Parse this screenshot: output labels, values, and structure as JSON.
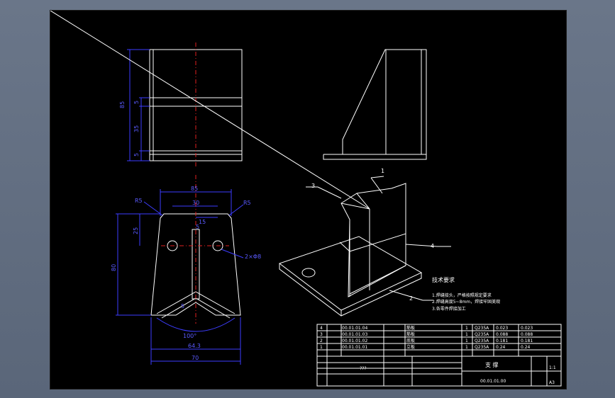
{
  "colors": {
    "background": "#5f6b7d",
    "sheet": "#000000",
    "geometry": "#ffffff",
    "dimension": "#3d3dff",
    "centerline": "#e02020"
  },
  "dimensions": {
    "front_height_total": "85",
    "front_mid": "35",
    "front_bottom": "5",
    "front_upper": "5",
    "plan_top_width": "85",
    "plan_inner_width": "30",
    "plan_hole_offset": "15",
    "plan_slot": "5",
    "plan_top_depth": "25",
    "plan_height": "80",
    "plan_hole": "2×Φ8",
    "fillet_left": "R5",
    "fillet_right": "R5",
    "angle": "100°",
    "width_lower": "64.3",
    "width_base": "70",
    "inner_dim": "5"
  },
  "leaders": [
    "1",
    "2",
    "3",
    "4"
  ],
  "tech": {
    "title": "技术要求",
    "items": [
      "1.焊缝接头，严格按照规定要求",
      "2.焊缝高度5~8mm，焊接牢固美观",
      "3.各零件焊接加工"
    ]
  },
  "bom": [
    {
      "no": "4",
      "code": "00.01.01.04",
      "name": "筋板",
      "qty": "1",
      "mat": "Q235A",
      "w1": "0.023",
      "w2": "0.023"
    },
    {
      "no": "3",
      "code": "00.01.01.03",
      "name": "筋板",
      "qty": "1",
      "mat": "Q235A",
      "w1": "0.088",
      "w2": "0.088"
    },
    {
      "no": "2",
      "code": "00.01.01.02",
      "name": "底板",
      "qty": "1",
      "mat": "Q235A",
      "w1": "0.181",
      "w2": "0.181"
    },
    {
      "no": "1",
      "code": "00.01.01.01",
      "name": "立板",
      "qty": "1",
      "mat": "Q235A",
      "w1": "0.24",
      "w2": "0.24"
    }
  ],
  "title_block": {
    "part_name": "支 撑",
    "drawing_no": "00.01.01.00",
    "sheet_size": "A3",
    "scale": "1:1",
    "company": "???"
  }
}
